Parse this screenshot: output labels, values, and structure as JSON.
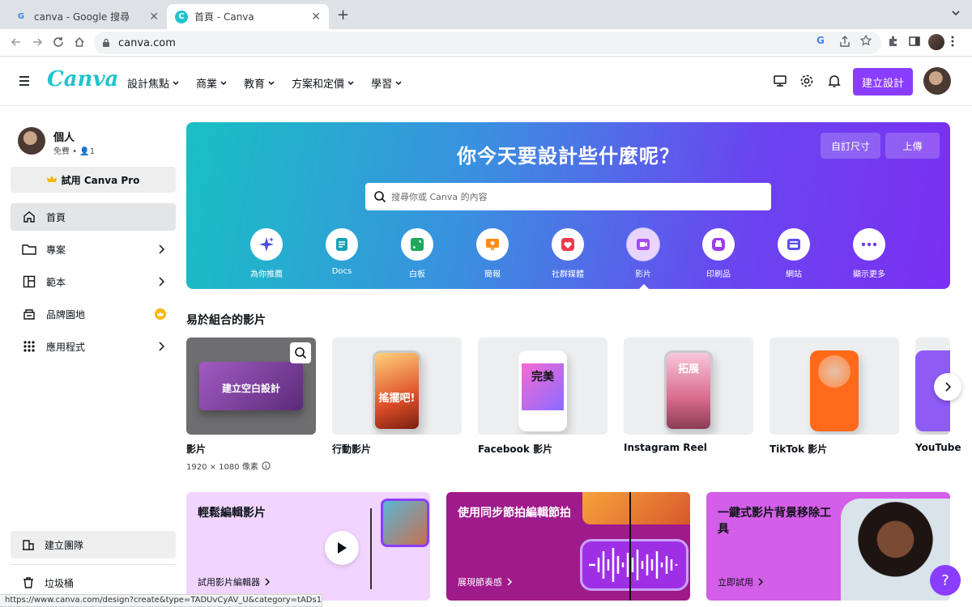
{
  "browser": {
    "tabs": [
      {
        "title": "canva - Google 搜尋",
        "favicon": "G"
      },
      {
        "title": "首頁 - Canva",
        "favicon": "C"
      }
    ],
    "url": "canva.com",
    "status_url": "https://www.canva.com/design?create&type=TADUvCyAV_U&category=tADs1de..."
  },
  "header": {
    "logo": "Canva",
    "nav": [
      {
        "label": "設計焦點"
      },
      {
        "label": "商業"
      },
      {
        "label": "教育"
      },
      {
        "label": "方案和定價"
      },
      {
        "label": "學習"
      }
    ],
    "create_label": "建立設計"
  },
  "sidebar": {
    "profile_name": "個人",
    "profile_plan": "免費 • ",
    "profile_members": "1",
    "pro_label": "試用 Canva Pro",
    "items": [
      {
        "label": "首頁"
      },
      {
        "label": "專案"
      },
      {
        "label": "範本"
      },
      {
        "label": "品牌園地"
      },
      {
        "label": "應用程式"
      }
    ],
    "team_label": "建立團隊",
    "trash_label": "垃圾桶"
  },
  "hero": {
    "title": "你今天要設計些什麼呢？",
    "custom_size": "自訂尺寸",
    "upload": "上傳",
    "search_placeholder": "搜尋你或 Canva 的內容",
    "categories": [
      {
        "label": "為你推薦",
        "icon": "sparkle-icon"
      },
      {
        "label": "Docs",
        "icon": "docs-icon"
      },
      {
        "label": "白板",
        "icon": "whiteboard-icon"
      },
      {
        "label": "簡報",
        "icon": "presentation-icon"
      },
      {
        "label": "社群媒體",
        "icon": "heart-icon"
      },
      {
        "label": "影片",
        "icon": "video-icon"
      },
      {
        "label": "印刷品",
        "icon": "printer-icon"
      },
      {
        "label": "網站",
        "icon": "website-icon"
      },
      {
        "label": "顯示更多",
        "icon": "more-icon"
      }
    ]
  },
  "videos": {
    "section_title": "易於組合的影片",
    "blank_label": "建立空白設計",
    "cards": [
      {
        "title": "影片",
        "art": ""
      },
      {
        "title": "行動影片",
        "art": "搖擺吧!"
      },
      {
        "title": "Facebook 影片",
        "art": "完美"
      },
      {
        "title": "Instagram Reel",
        "art": "拓展"
      },
      {
        "title": "TikTok 影片",
        "art": ""
      },
      {
        "title": "YouTube",
        "art": ""
      }
    ],
    "first_sub": "1920 × 1080 像素"
  },
  "promos": [
    {
      "title": "輕鬆編輯影片",
      "link": "試用影片編輯器"
    },
    {
      "title": "使用同步節拍編輯節拍",
      "link": "展現節奏感"
    },
    {
      "title": "一鍵式影片背景移除工具",
      "link": "立即試用"
    }
  ],
  "help_label": "?",
  "colors": {
    "brand": "#8b3dff",
    "logo": "#20c4cb"
  }
}
